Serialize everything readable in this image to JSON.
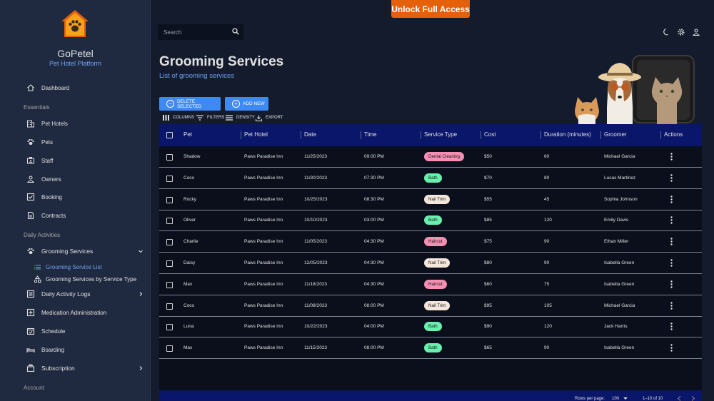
{
  "app": {
    "name": "GoPetel",
    "subtitle": "Pet Hotel Platform",
    "unlock_label": "Unlock Full Access"
  },
  "colors": {
    "accent": "#3d8bf2",
    "unlock": "#e5600b",
    "table_header": "#0a1669",
    "chip_dental": "#f48fb1",
    "chip_bath": "#69f0ae",
    "chip_nail": "#f5e6dc",
    "chip_haircut": "#f48fb1"
  },
  "sidebar": {
    "dashboard": "Dashboard",
    "essentials_header": "Essentials",
    "essentials": [
      {
        "label": "Pet Hotels",
        "icon": "building-icon"
      },
      {
        "label": "Pets",
        "icon": "paw-icon"
      },
      {
        "label": "Staff",
        "icon": "badge-icon"
      },
      {
        "label": "Owners",
        "icon": "person-icon"
      },
      {
        "label": "Booking",
        "icon": "checkbox-icon"
      },
      {
        "label": "Contracts",
        "icon": "document-icon"
      }
    ],
    "daily_header": "Daily Activities",
    "grooming": "Grooming Services",
    "grooming_list": "Grooming Service List",
    "grooming_by_type": "Grooming Services by Service Type",
    "daily_logs": "Daily Activity Logs",
    "medication": "Medication Administration",
    "schedule": "Schedule",
    "boarding": "Boarding",
    "subscription": "Subscription",
    "account_header": "Account"
  },
  "search": {
    "placeholder": "Search"
  },
  "page": {
    "title": "Grooming Services",
    "subtitle": "List of grooming services"
  },
  "actions": {
    "delete_selected": "DELETE SELECTED",
    "add_new": "ADD NEW",
    "columns": "COLUMNS",
    "filters": "FILTERS",
    "density": "DENSITY",
    "export": "EXPORT"
  },
  "table": {
    "headers": [
      "Pet",
      "Pet Hotel",
      "Date",
      "Time",
      "Service Type",
      "Cost",
      "Duration (minutes)",
      "Groomer",
      "Actions"
    ],
    "rows": [
      {
        "pet": "Shadow",
        "hotel": "Paws Paradise Inn",
        "date": "11/25/2023",
        "time": "09:00 PM",
        "service": "Dental Cleaning",
        "cost": "$50",
        "duration": "60",
        "groomer": "Michael Garcia"
      },
      {
        "pet": "Coco",
        "hotel": "Paws Paradise Inn",
        "date": "11/30/2023",
        "time": "07:30 PM",
        "service": "Bath",
        "cost": "$70",
        "duration": "80",
        "groomer": "Lucas Martinez"
      },
      {
        "pet": "Rocky",
        "hotel": "Paws Paradise Inn",
        "date": "10/25/2023",
        "time": "08:30 PM",
        "service": "Nail Trim",
        "cost": "$55",
        "duration": "45",
        "groomer": "Sophia Johnson"
      },
      {
        "pet": "Oliver",
        "hotel": "Paws Paradise Inn",
        "date": "10/10/2023",
        "time": "03:00 PM",
        "service": "Bath",
        "cost": "$85",
        "duration": "120",
        "groomer": "Emily Davis"
      },
      {
        "pet": "Charlie",
        "hotel": "Paws Paradise Inn",
        "date": "11/05/2023",
        "time": "04:30 PM",
        "service": "Haircut",
        "cost": "$75",
        "duration": "90",
        "groomer": "Ethan Miller"
      },
      {
        "pet": "Daisy",
        "hotel": "Paws Paradise Inn",
        "date": "12/05/2023",
        "time": "04:30 PM",
        "service": "Nail Trim",
        "cost": "$80",
        "duration": "90",
        "groomer": "Isabella Green"
      },
      {
        "pet": "Max",
        "hotel": "Paws Paradise Inn",
        "date": "11/18/2023",
        "time": "04:30 PM",
        "service": "Haircut",
        "cost": "$60",
        "duration": "75",
        "groomer": "Isabella Green"
      },
      {
        "pet": "Coco",
        "hotel": "Paws Paradise Inn",
        "date": "11/08/2023",
        "time": "08:00 PM",
        "service": "Nail Trim",
        "cost": "$95",
        "duration": "105",
        "groomer": "Michael Garcia"
      },
      {
        "pet": "Luna",
        "hotel": "Paws Paradise Inn",
        "date": "10/22/2023",
        "time": "04:00 PM",
        "service": "Bath",
        "cost": "$90",
        "duration": "120",
        "groomer": "Jack Harris"
      },
      {
        "pet": "Max",
        "hotel": "Paws Paradise Inn",
        "date": "11/15/2023",
        "time": "08:00 PM",
        "service": "Bath",
        "cost": "$65",
        "duration": "90",
        "groomer": "Isabella Green"
      }
    ]
  },
  "pagination": {
    "rows_per_page_label": "Rows per page:",
    "rows_per_page": "100",
    "range": "1–10 of 10"
  }
}
